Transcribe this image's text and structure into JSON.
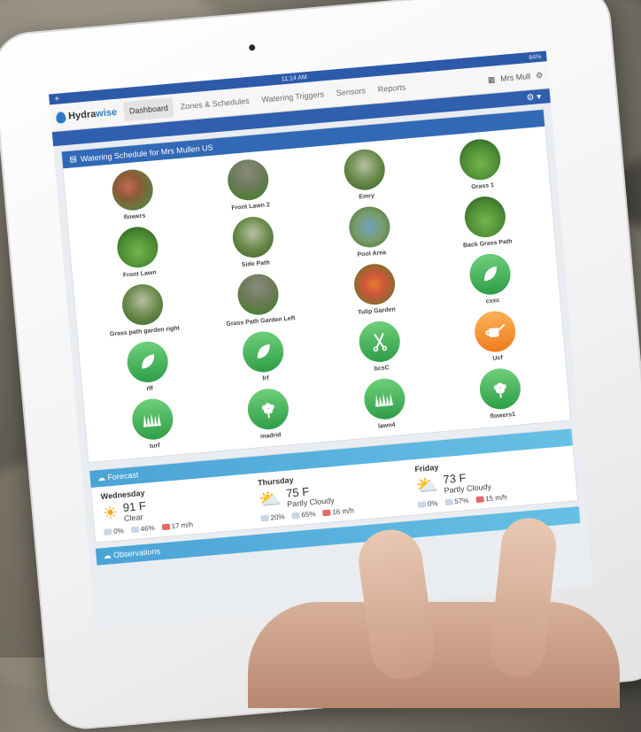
{
  "status": {
    "left": "✈",
    "time": "11:14 AM",
    "battery": "84%"
  },
  "nav": {
    "logo_text_a": "Hydra",
    "logo_text_b": "wise",
    "tabs": [
      "Dashboard",
      "Zones & Schedules",
      "Watering Triggers",
      "Sensors",
      "Reports"
    ],
    "user": "Mrs Mull"
  },
  "schedule": {
    "title": "Watering Schedule for Mrs Mullen US",
    "zones": [
      {
        "name": "flowers",
        "icon": "flower-bed-photo"
      },
      {
        "name": "Front Lawn 2",
        "icon": "house-lawn-photo"
      },
      {
        "name": "Emry",
        "icon": "garden-photo"
      },
      {
        "name": "Grass 1",
        "icon": "grass-photo"
      },
      {
        "name": "Front Lawn",
        "icon": "lawn-photo"
      },
      {
        "name": "Side Path",
        "icon": "path-photo"
      },
      {
        "name": "Pool Area",
        "icon": "pool-photo"
      },
      {
        "name": "Back Grass Path",
        "icon": "grass-path-photo"
      },
      {
        "name": "Grass path garden right",
        "icon": "garden-path-photo"
      },
      {
        "name": "Grass Path Garden Left",
        "icon": "garden-path-photo"
      },
      {
        "name": "Tulip Garden",
        "icon": "tulip-photo"
      },
      {
        "name": "cxxc",
        "icon": "leaf-icon"
      },
      {
        "name": "rff",
        "icon": "leaf-icon"
      },
      {
        "name": "frf",
        "icon": "leaf-icon"
      },
      {
        "name": "bcsC",
        "icon": "shears-icon"
      },
      {
        "name": "Ucf",
        "icon": "watering-can-icon"
      },
      {
        "name": "turf",
        "icon": "grass-icon"
      },
      {
        "name": "madrid",
        "icon": "flower-icon"
      },
      {
        "name": "lawn4",
        "icon": "grass-icon"
      },
      {
        "name": "flowers1",
        "icon": "flower-icon"
      }
    ]
  },
  "forecast": {
    "title": "Forecast",
    "days": [
      {
        "day": "Wednesday",
        "temp": "91 F",
        "cond": "Clear",
        "rain": "0%",
        "humidity": "46%",
        "wind": "17 m/h",
        "icon": "sun-icon"
      },
      {
        "day": "Thursday",
        "temp": "75 F",
        "cond": "Partly Cloudy",
        "rain": "20%",
        "humidity": "65%",
        "wind": "16 m/h",
        "icon": "partly-cloudy-icon"
      },
      {
        "day": "Friday",
        "temp": "73 F",
        "cond": "Partly Cloudy",
        "rain": "0%",
        "humidity": "57%",
        "wind": "15 m/h",
        "icon": "partly-cloudy-icon"
      }
    ]
  },
  "observations": {
    "title": "Observations"
  }
}
